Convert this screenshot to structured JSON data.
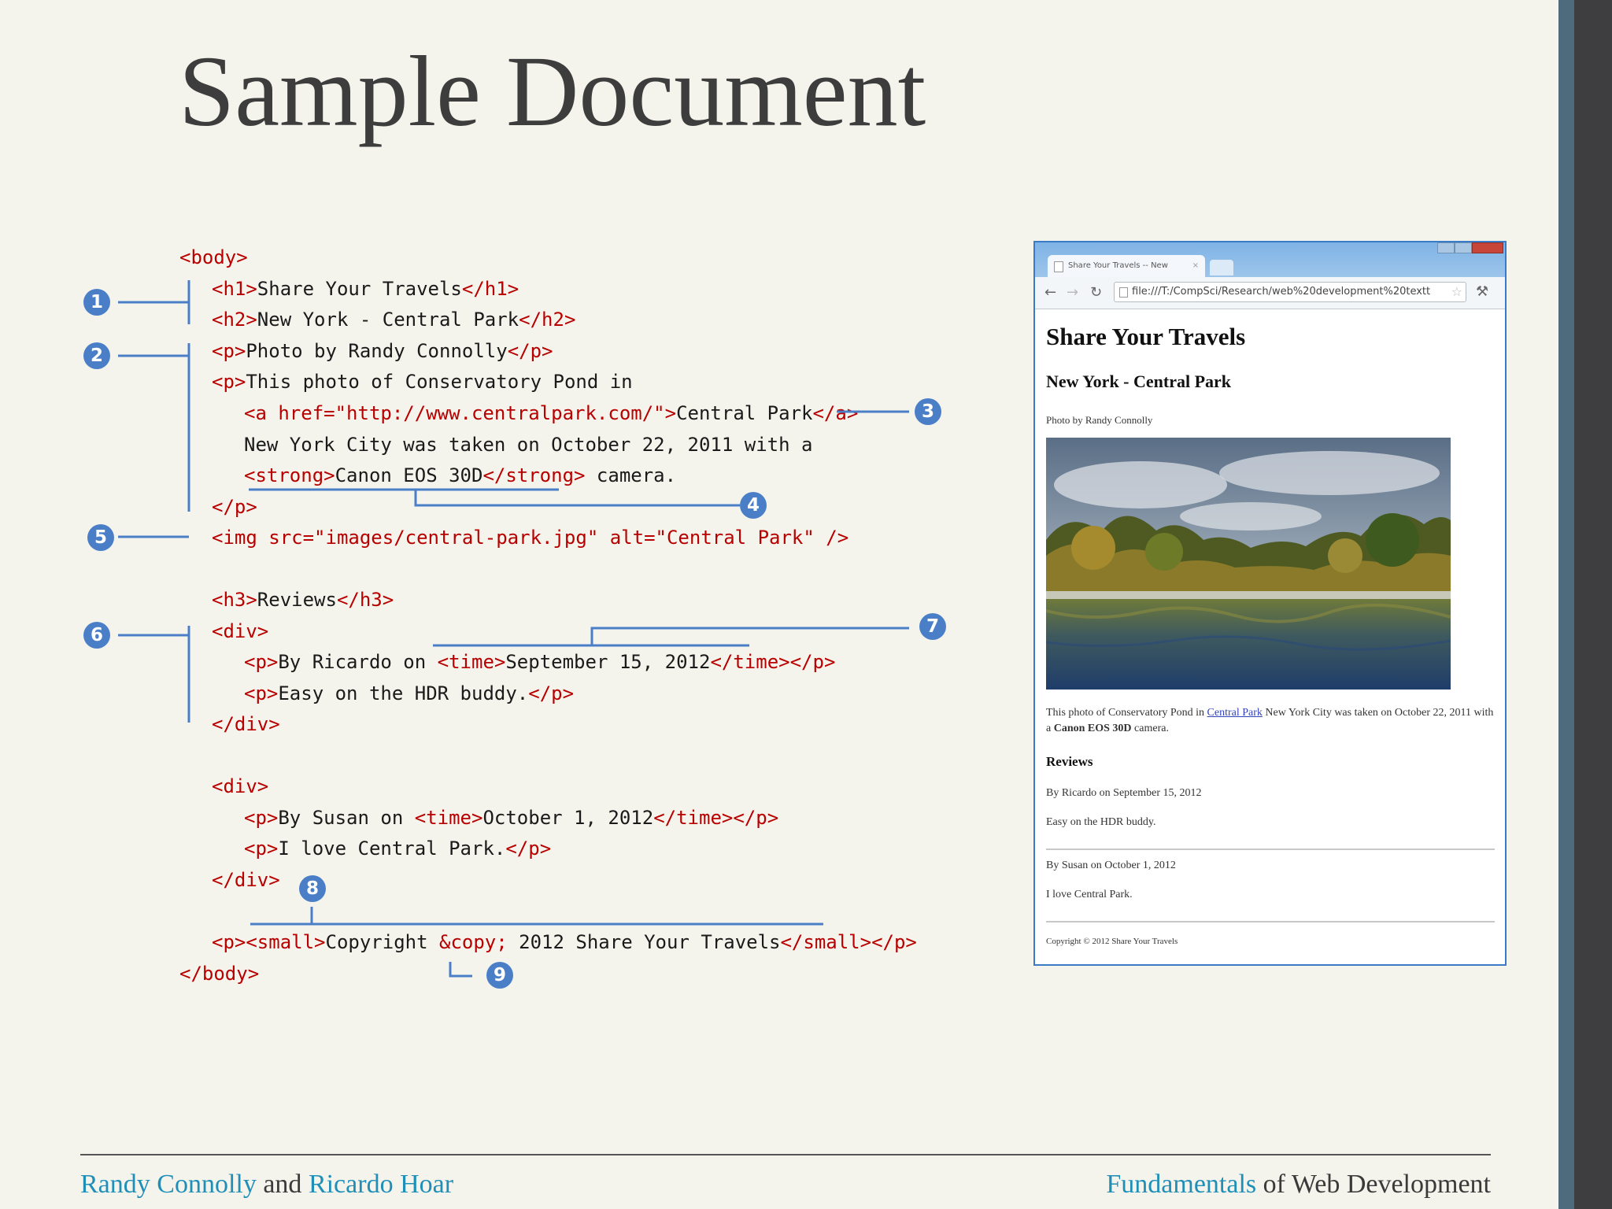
{
  "slide": {
    "title": "Sample Document"
  },
  "code": {
    "lines": [
      {
        "name": "body-open",
        "parts": [
          {
            "t": "<body>",
            "tag": true
          }
        ]
      },
      {
        "name": "h1",
        "parts": [
          {
            "t": "<h1>",
            "tag": true
          },
          {
            "t": "Share Your Travels",
            "tag": false
          },
          {
            "t": "</h1>",
            "tag": true
          }
        ]
      },
      {
        "name": "h2",
        "parts": [
          {
            "t": "<h2>",
            "tag": true
          },
          {
            "t": "New York - Central Park",
            "tag": false
          },
          {
            "t": "</h2>",
            "tag": true
          }
        ]
      },
      {
        "name": "p-photo-by",
        "parts": [
          {
            "t": "<p>",
            "tag": true
          },
          {
            "t": "Photo by Randy Connolly",
            "tag": false
          },
          {
            "t": "</p>",
            "tag": true
          }
        ]
      },
      {
        "name": "p-open",
        "parts": [
          {
            "t": "<p>",
            "tag": true
          },
          {
            "t": "This photo of Conservatory Pond in",
            "tag": false
          }
        ]
      },
      {
        "name": "anchor",
        "parts": [
          {
            "t": "<a href=\"http://www.centralpark.com/\">",
            "tag": true
          },
          {
            "t": "Central Park",
            "tag": false
          },
          {
            "t": "</a>",
            "tag": true
          }
        ]
      },
      {
        "name": "text-nyc",
        "parts": [
          {
            "t": "New York City was taken on October 22, 2011 with a",
            "tag": false
          }
        ]
      },
      {
        "name": "strong",
        "parts": [
          {
            "t": "<strong>",
            "tag": true
          },
          {
            "t": "Canon EOS 30D",
            "tag": false
          },
          {
            "t": "</strong>",
            "tag": true
          },
          {
            "t": " camera.",
            "tag": false
          }
        ]
      },
      {
        "name": "p-close",
        "parts": [
          {
            "t": "</p>",
            "tag": true
          }
        ]
      },
      {
        "name": "img",
        "parts": [
          {
            "t": "<img src=\"images/central-park.jpg\" alt=\"Central Park\" />",
            "tag": true
          }
        ]
      },
      {
        "name": "h3",
        "parts": [
          {
            "t": "<h3>",
            "tag": true
          },
          {
            "t": "Reviews",
            "tag": false
          },
          {
            "t": "</h3>",
            "tag": true
          }
        ]
      },
      {
        "name": "div1-open",
        "parts": [
          {
            "t": "<div>",
            "tag": true
          }
        ]
      },
      {
        "name": "review1-by",
        "parts": [
          {
            "t": "<p>",
            "tag": true
          },
          {
            "t": "By Ricardo on ",
            "tag": false
          },
          {
            "t": "<time>",
            "tag": true
          },
          {
            "t": "September 15, 2012",
            "tag": false
          },
          {
            "t": "</time></p>",
            "tag": true
          }
        ]
      },
      {
        "name": "review1-text",
        "parts": [
          {
            "t": "<p>",
            "tag": true
          },
          {
            "t": "Easy on the HDR buddy.",
            "tag": false
          },
          {
            "t": "</p>",
            "tag": true
          }
        ]
      },
      {
        "name": "div1-close",
        "parts": [
          {
            "t": "</div>",
            "tag": true
          }
        ]
      },
      {
        "name": "div2-open",
        "parts": [
          {
            "t": "<div>",
            "tag": true
          }
        ]
      },
      {
        "name": "review2-by",
        "parts": [
          {
            "t": "<p>",
            "tag": true
          },
          {
            "t": "By Susan on ",
            "tag": false
          },
          {
            "t": "<time>",
            "tag": true
          },
          {
            "t": "October 1, 2012",
            "tag": false
          },
          {
            "t": "</time></p>",
            "tag": true
          }
        ]
      },
      {
        "name": "review2-text",
        "parts": [
          {
            "t": "<p>",
            "tag": true
          },
          {
            "t": "I love Central Park.",
            "tag": false
          },
          {
            "t": "</p>",
            "tag": true
          }
        ]
      },
      {
        "name": "div2-close",
        "parts": [
          {
            "t": "</div>",
            "tag": true
          }
        ]
      },
      {
        "name": "copyright",
        "parts": [
          {
            "t": "<p><small>",
            "tag": true
          },
          {
            "t": "Copyright ",
            "tag": false
          },
          {
            "t": "&copy;",
            "tag": true
          },
          {
            "t": " 2012 Share Your Travels",
            "tag": false
          },
          {
            "t": "</small></p>",
            "tag": true
          }
        ]
      },
      {
        "name": "body-close",
        "parts": [
          {
            "t": "</body>",
            "tag": true
          }
        ]
      }
    ],
    "callouts": [
      "1",
      "2",
      "3",
      "4",
      "5",
      "6",
      "7",
      "8",
      "9"
    ]
  },
  "browser": {
    "tab_title": "Share Your Travels -- New",
    "tab_close": "×",
    "url": "file:///T:/CompSci/Research/web%20development%20textt",
    "page": {
      "h1": "Share Your Travels",
      "h2": "New York - Central Park",
      "photo_by": "Photo by Randy Connolly",
      "caption_before": "This photo of Conservatory Pond in ",
      "caption_link": "Central Park",
      "caption_mid": " New York City was taken on October 22, 2011 with a ",
      "caption_strong": "Canon EOS 30D",
      "caption_after": " camera.",
      "reviews_heading": "Reviews",
      "review1_by": "By Ricardo on September 15, 2012",
      "review1_text": "Easy on the HDR buddy.",
      "review2_by": "By Susan on October 1, 2012",
      "review2_text": "I love Central Park.",
      "copyright": "Copyright © 2012 Share Your Travels"
    }
  },
  "footer": {
    "author1": "Randy Connolly",
    "and": " and ",
    "author2": "Ricardo Hoar",
    "book_hl": "Fundamentals",
    "book_rest": " of Web Development"
  },
  "colors": {
    "tag": "#b80000",
    "callout": "#4a7fc8",
    "footer_accent": "#1f8fb8",
    "background": "#f4f4ec"
  }
}
